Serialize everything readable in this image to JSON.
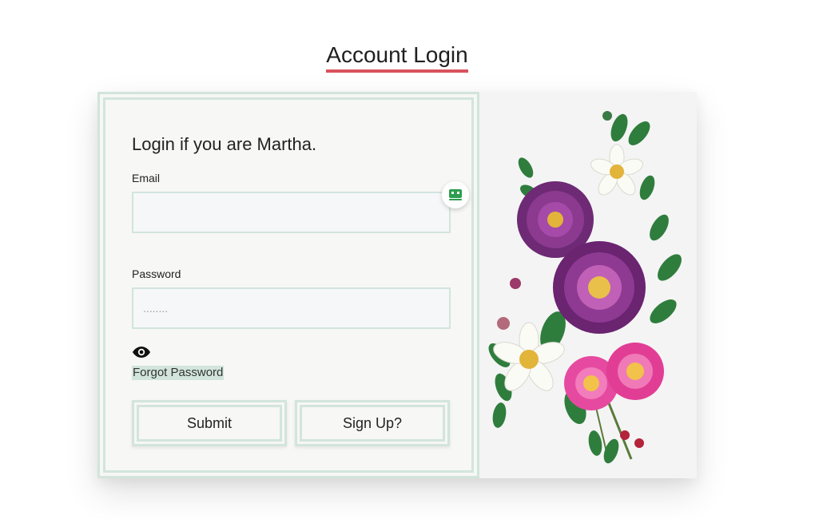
{
  "page": {
    "title": "Account Login",
    "accent_color": "#d9535d",
    "panel_border_color": "#d2e5dd"
  },
  "form": {
    "heading": "Login if you are Martha.",
    "email": {
      "label": "Email",
      "value": "",
      "placeholder": ""
    },
    "password": {
      "label": "Password",
      "placeholder": "........"
    },
    "show_password_icon": "eye-icon",
    "autofill_icon": "password-manager-icon",
    "forgot_password": "Forgot Password",
    "submit_label": "Submit",
    "signup_label": "Sign Up?"
  },
  "illustration": {
    "subject": "flower-bouquet",
    "colors": [
      "#7b2d7f",
      "#e64aa0",
      "#ffffff",
      "#2f7d3d"
    ]
  }
}
